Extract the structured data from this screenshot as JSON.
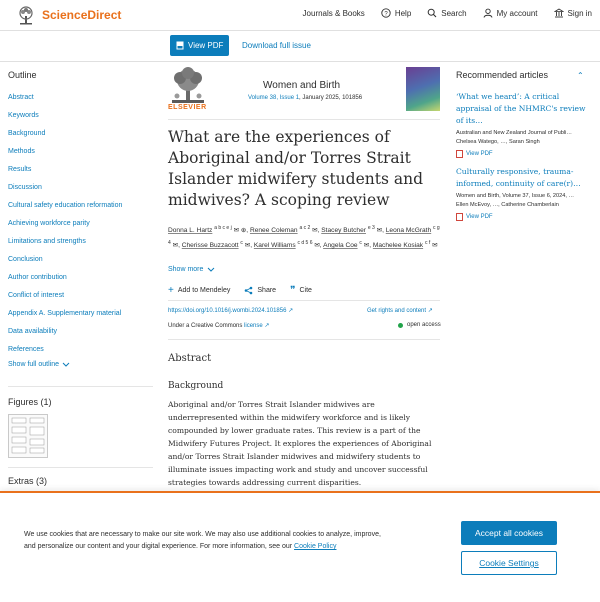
{
  "header": {
    "brand": "ScienceDirect",
    "nav": [
      {
        "label": "Journals & Books",
        "icon": ""
      },
      {
        "label": "Help",
        "icon": "help-icon"
      },
      {
        "label": "Search",
        "icon": "search-icon"
      },
      {
        "label": "My account",
        "icon": "user-icon"
      },
      {
        "label": "Sign in",
        "icon": "institution-icon"
      }
    ]
  },
  "actionbar": {
    "view_pdf": "View PDF",
    "download_issue": "Download full issue"
  },
  "outline": {
    "title": "Outline",
    "items": [
      "Abstract",
      "Keywords",
      "Background",
      "Methods",
      "Results",
      "Discussion",
      "Cultural safety education reformation",
      "Achieving workforce parity",
      "Limitations and strengths",
      "Conclusion",
      "Author contribution",
      "Conflict of interest",
      "Appendix A. Supplementary material",
      "Data availability",
      "References"
    ],
    "show_full": "Show full outline",
    "figures_title": "Figures (1)",
    "extras_title": "Extras (3)"
  },
  "journal": {
    "publisher": "ELSEVIER",
    "name": "Women and Birth",
    "volume_link": "Volume 38, Issue 1",
    "date_id": ", January 2025, 101856"
  },
  "article": {
    "title": "What are the experiences of Aboriginal and/or Torres Strait Islander midwifery students and midwives? A scoping review",
    "authors": [
      {
        "name": "Donna L. Hartz",
        "sup": "a b c e j",
        "mail": "✉ ⊕"
      },
      {
        "name": "Renee Coleman",
        "sup": "a c 2",
        "mail": "✉"
      },
      {
        "name": "Stacey Butcher",
        "sup": "e 3",
        "mail": "✉"
      },
      {
        "name": "Leona McGrath",
        "sup": "c g 4",
        "mail": "✉"
      },
      {
        "name": "Cherisse Buzzacott",
        "sup": "c",
        "mail": "✉"
      },
      {
        "name": "Karel Williams",
        "sup": "c d 5 6",
        "mail": "✉"
      },
      {
        "name": "Angela Coe",
        "sup": "c",
        "mail": "✉"
      },
      {
        "name": "Machelee Kosiak",
        "sup": "c f",
        "mail": "✉"
      }
    ],
    "show_more": "Show more",
    "tools": [
      {
        "label": "Add to Mendeley",
        "icon": "plus-icon"
      },
      {
        "label": "Share",
        "icon": "share-icon"
      },
      {
        "label": "Cite",
        "icon": "quote-icon"
      }
    ],
    "doi": "https://doi.org/10.1016/j.wombi.2024.101856 ↗",
    "rights": "Get rights and content ↗",
    "license_prefix": "Under a Creative Commons ",
    "license_link": "license ↗",
    "open_access": "open access",
    "abstract_heading": "Abstract",
    "background_heading": "Background",
    "background_text": "Aboriginal and/or Torres Strait Islander midwives are underrepresented within the midwifery workforce and is likely compounded by lower graduate rates. This review is a part of the Midwifery Futures Project. It explores the experiences of Aboriginal and/or Torres Strait Islander midwives and midwifery students to illuminate issues impacting work and study and uncover successful strategies towards addressing current disparities."
  },
  "recommended": {
    "title": "Recommended articles",
    "items": [
      {
        "title": "‘What we heard’: A critical appraisal of the NHMRC's review of its…",
        "meta": "Australian and New Zealand Journal of Publi…",
        "authors": "Chelsea Watego, …, Saran Singh",
        "pdf": "View PDF"
      },
      {
        "title": "Culturally responsive, trauma-informed, continuity of care(r)…",
        "meta": "Women and Birth, Volume 37, Issue 6, 2024, …",
        "authors": "Ellen McEvoy, …, Catherine Chamberlain",
        "pdf": "View PDF"
      }
    ]
  },
  "cookie": {
    "text": "We use cookies that are necessary to make our site work. We may also use additional cookies to analyze, improve, and personalize our content and your digital experience. For more information, see our ",
    "link": "Cookie Policy",
    "accept": "Accept all cookies",
    "settings": "Cookie Settings"
  },
  "colors": {
    "brand": "#e9711c",
    "link": "#0c7dbb",
    "open_access": "#22a34a"
  }
}
